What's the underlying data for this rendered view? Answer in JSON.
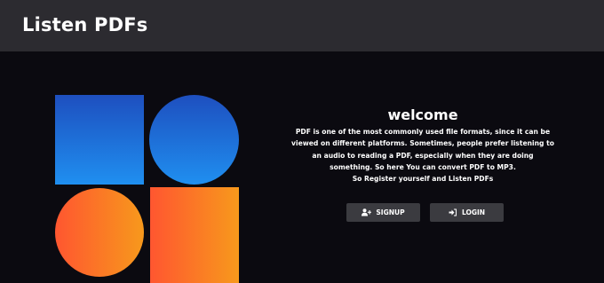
{
  "navbar": {
    "brand": "Listen PDFs"
  },
  "logo": {
    "colors": {
      "blue_top": "#1e4fbf",
      "blue_bottom": "#1f8ff0",
      "orange_left": "#ff5630",
      "orange_right": "#f7991c"
    }
  },
  "main": {
    "heading": "welcome",
    "description_lines": [
      "PDF is one of the most commonly used file formats, since it can be",
      "viewed on different platforms. Sometimes, people prefer listening to",
      "an audio to reading a PDF, especially when they are doing",
      "something. So here You can convert PDF to MP3.",
      "So Register yourself and Listen PDFs"
    ]
  },
  "buttons": {
    "signup": {
      "label": "SIGNUP",
      "icon": "user-plus-icon"
    },
    "login": {
      "label": "LOGIN",
      "icon": "sign-in-icon"
    }
  },
  "theme": {
    "background": "#0b0a10",
    "navbar": "#2c2b30",
    "button": "#3b3b40",
    "text": "#ffffff"
  }
}
